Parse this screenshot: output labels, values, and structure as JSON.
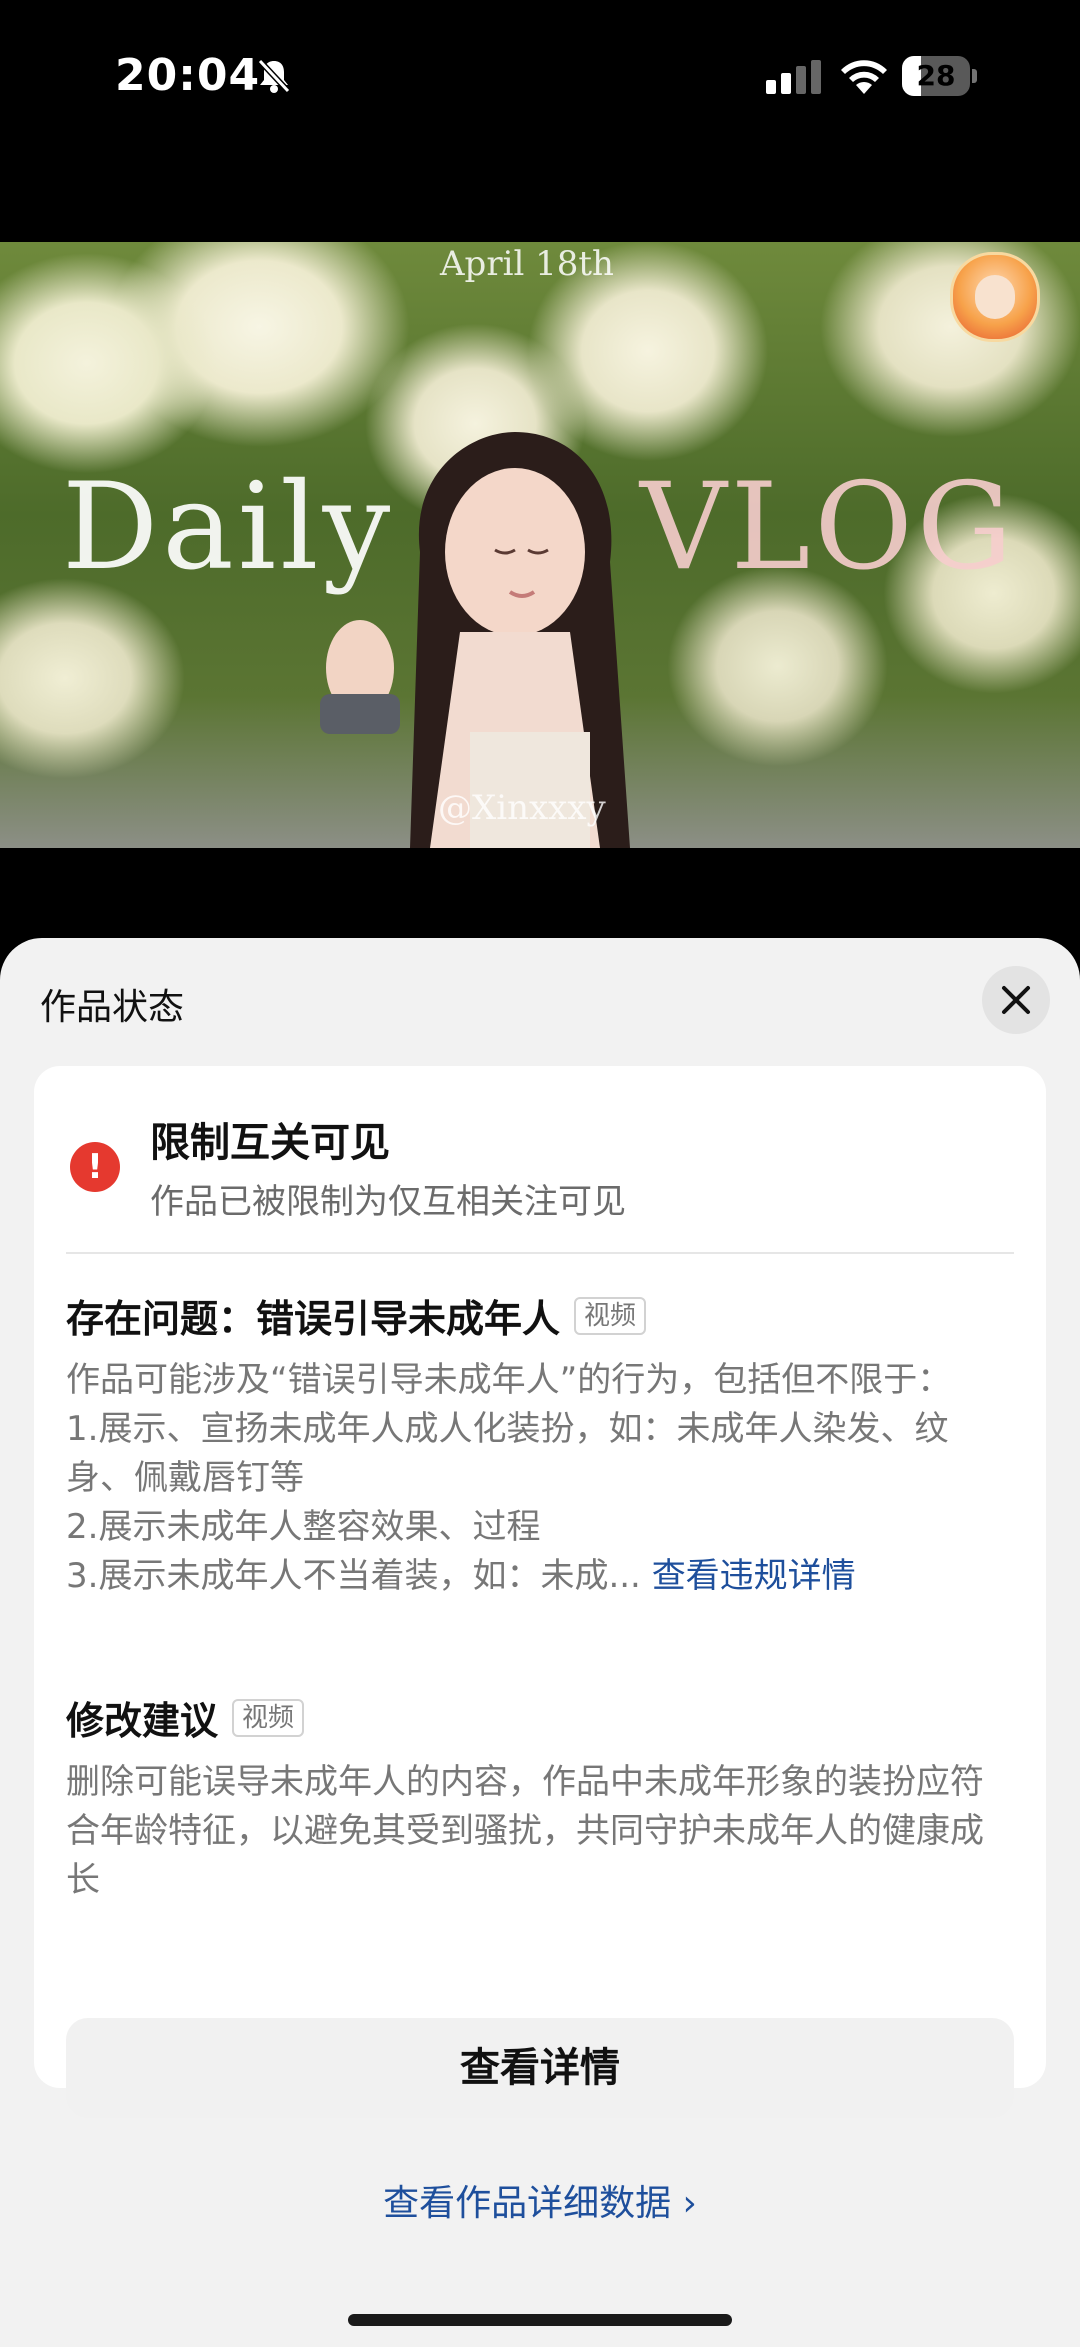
{
  "status_bar": {
    "time": "20:04",
    "battery_level": "28",
    "battery_fraction": 0.28,
    "icons": [
      "bell-slash-icon",
      "cellular-signal-icon",
      "wifi-icon",
      "battery-icon"
    ]
  },
  "video": {
    "overlay_date": "April 18th",
    "overlay_title_left": "Daily",
    "overlay_title_right": "VLOG",
    "overlay_handle": "@Xinxxxy"
  },
  "sheet": {
    "title": "作品状态",
    "close_icon": "close-icon",
    "status": {
      "title": "限制互关可见",
      "description": "作品已被限制为仅互相关注可见",
      "icon": "warning-icon",
      "icon_color": "#e5392f"
    },
    "issue": {
      "title": "存在问题：错误引导未成年人",
      "tag": "视频",
      "line1": "作品可能涉及“错误引导未成年人”的行为，包括但不限于：",
      "line2": "1.展示、宣扬未成年人成人化装扮，如：未成年人染发、纹身、佩戴唇钉等",
      "line3": "2.展示未成年人整容效果、过程",
      "line4": "3.展示未成年人不当着装，如：未成...",
      "more_link": "查看违规详情"
    },
    "suggestion": {
      "title": "修改建议",
      "tag": "视频",
      "body": "删除可能误导未成年人的内容，作品中未成年形象的装扮应符合年龄特征，以避免其受到骚扰，共同守护未成年人的健康成长"
    },
    "detail_button": "查看详情",
    "data_link": "查看作品详细数据 ›",
    "link_color": "#1e4f9c"
  }
}
